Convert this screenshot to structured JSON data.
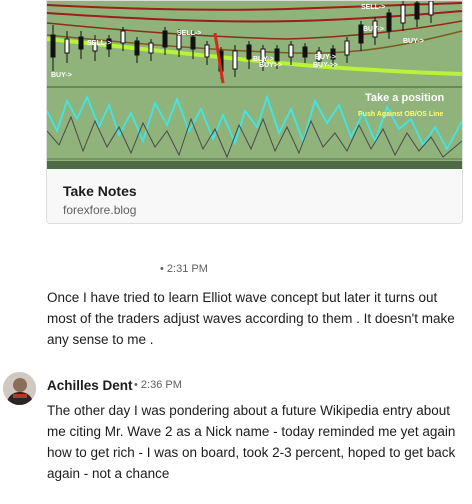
{
  "link_card": {
    "title": "Take Notes",
    "domain": "forexfore.blog",
    "image": {
      "overlay_heading": "Take a position",
      "overlay_subtext": "Push Against OB/OS Line",
      "signal_labels": [
        "SELL->",
        "SELL->",
        "SELL->",
        "BUY->",
        "BUY->",
        "BUY->",
        "BUY->",
        "BUY>>",
        "BUY->>",
        "BUY->"
      ],
      "colors": {
        "price_panel": "#8fb37a",
        "oscillator_panel": "#8fb37a",
        "moving_average_band": "#9d1c1c",
        "support_line": "#b8f23a",
        "oscillator_primary": "#3fe6e6",
        "oscillator_secondary": "#4a4a4a"
      }
    }
  },
  "messages": [
    {
      "time": "• 2:31 PM",
      "text": "Once I have tried to learn Elliot wave concept but later it turns out most of the traders adjust waves according to them . It doesn't make any sense to me ."
    },
    {
      "author": "Achilles Dent",
      "time": "• 2:36 PM",
      "text": "The other day I was pondering about a future Wikipedia entry about me citing Mr. Wave 2 as a Nick name - today reminded me yet again how to get rich -  I was on board, took 2-3 percent, hoped to get back again - not a chance"
    }
  ]
}
